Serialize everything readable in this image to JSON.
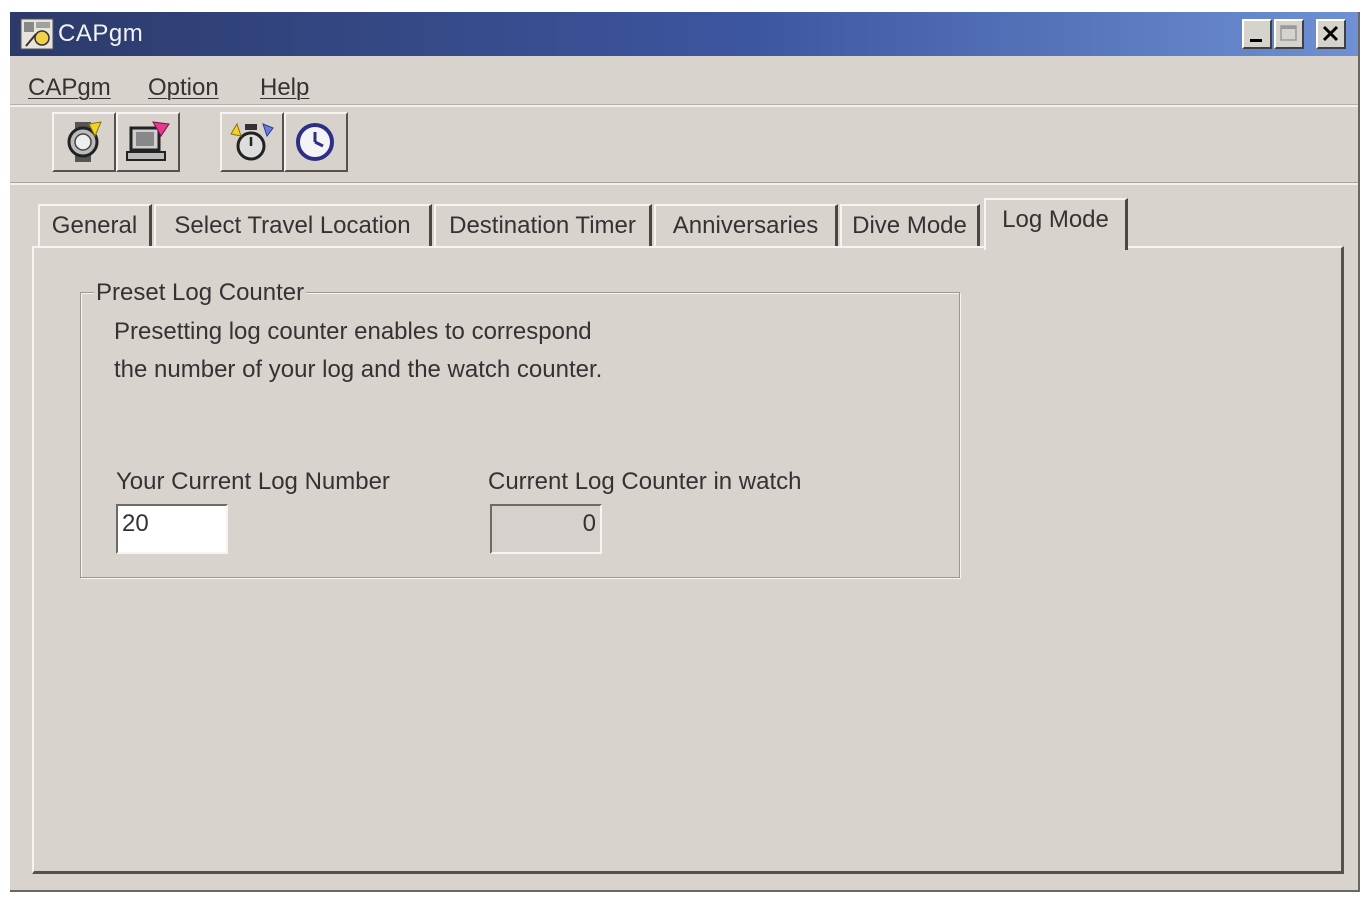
{
  "window": {
    "title": "CAPgm",
    "icon": "app-icon",
    "controls": [
      "minimize-icon",
      "maximize-icon",
      "close-icon"
    ]
  },
  "menu": [
    {
      "label": "CAPgm"
    },
    {
      "label": "Option"
    },
    {
      "label": "Help"
    }
  ],
  "toolbar": [
    {
      "icon": "watch-connect-icon"
    },
    {
      "icon": "pc-transfer-icon"
    },
    {
      "icon": "stopwatch-icon"
    },
    {
      "icon": "clock-icon"
    }
  ],
  "tabs": [
    {
      "label": "General",
      "active": false
    },
    {
      "label": "Select Travel Location",
      "active": false
    },
    {
      "label": "Destination Timer",
      "active": false
    },
    {
      "label": "Anniversaries",
      "active": false
    },
    {
      "label": "Dive Mode",
      "active": false
    },
    {
      "label": "Log Mode",
      "active": true
    }
  ],
  "preset": {
    "title": "Preset Log Counter",
    "description_line1": "Presetting log counter enables to correspond",
    "description_line2": "the number of your log and the watch counter.",
    "current_log_label": "Your Current Log Number",
    "current_log_value": "20",
    "watch_counter_label": "Current Log Counter in watch",
    "watch_counter_value": "0"
  },
  "colors": {
    "title_bar_start": "#2c3a6a",
    "title_bar_end": "#6f90d4",
    "face": "#d9d3ce"
  }
}
